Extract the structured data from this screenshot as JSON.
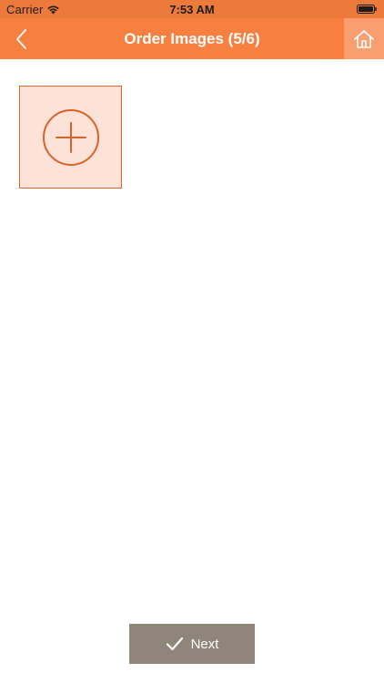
{
  "status_bar": {
    "carrier": "Carrier",
    "time": "7:53 AM"
  },
  "nav": {
    "title": "Order Images (5/6)"
  },
  "footer": {
    "next_label": "Next"
  },
  "icons": {
    "back": "chevron-left-icon",
    "home": "home-icon",
    "add": "plus-circle-icon",
    "check": "checkmark-icon",
    "wifi": "wifi-icon",
    "battery": "battery-icon"
  },
  "colors": {
    "accent": "#f77f3f",
    "status_bar": "#ed7a3a",
    "home_button": "#fa9e70",
    "add_tile_fill": "#fde2d8",
    "add_tile_border": "#e0672d",
    "next_button": "#8f857a"
  }
}
